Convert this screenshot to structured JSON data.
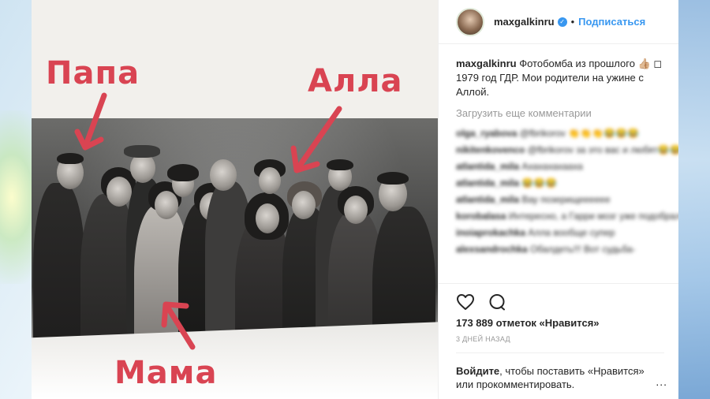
{
  "post": {
    "username": "maxgalkinru",
    "separator": "•",
    "follow_label": "Подписаться",
    "caption_username": "maxgalkinru",
    "caption_text": "Фотобомба из прошлого 👍🏼 ◻ 1979 год ГДР. Мои родители на ужине с Аллой.",
    "load_more_label": "Загрузить еще комментарии",
    "comments": [
      {
        "user": "olga_ryabova",
        "text": "@fbrikorov 👏👏👏😂😂😂"
      },
      {
        "user": "nikitenkovenco",
        "text": "@fbrikorov за это вас и любят😂😂😂"
      },
      {
        "user": "atlantida_mila",
        "text": "Ахахахахааха"
      },
      {
        "user": "atlantida_mila",
        "text": "😂😂😂"
      },
      {
        "user": "atlantida_mila",
        "text": "Вау позерищееееее"
      },
      {
        "user": "korobalasa",
        "text": "Интересно, а Гарри мозг уже подобрала?"
      },
      {
        "user": "inoiaprokachka",
        "text": "Алла вообще супер"
      },
      {
        "user": "alexsandrochka",
        "text": "Обалдеть!!! Вот судьба-"
      }
    ],
    "likes_text": "173 889 отметок «Нравится»",
    "date_text": "3 ДНЕЙ НАЗАД",
    "login_link": "Войдите",
    "login_text": ", чтобы поставить «Нравится» или прокомментировать.",
    "more_label": "..."
  },
  "photo": {
    "label_papa": "Папа",
    "label_alla": "Алла",
    "label_mama": "Мама",
    "label_color": "#d94452"
  },
  "icons": {
    "like": "heart-outline-icon",
    "comment": "comment-bubble-icon",
    "verified": "verified-badge-icon",
    "more": "more-options-icon"
  }
}
